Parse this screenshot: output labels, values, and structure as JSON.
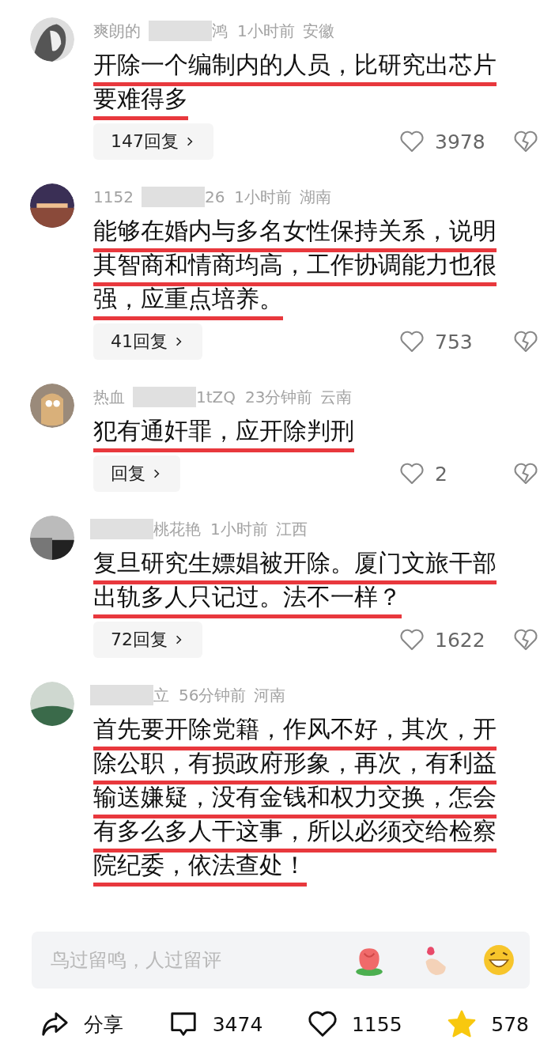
{
  "comments": [
    {
      "name_parts": [
        {
          "kind": "text",
          "text": "爽朗的"
        },
        {
          "kind": "blur"
        },
        {
          "kind": "text",
          "text": "鸿"
        }
      ],
      "time": "1小时前",
      "location": "安徽",
      "text": "开除一个编制内的人员，比研究出芯片要难得多",
      "marked": true,
      "reply": "147回复",
      "likes": "3978",
      "liked": false
    },
    {
      "name_parts": [
        {
          "kind": "text",
          "text": "1152"
        },
        {
          "kind": "blur"
        },
        {
          "kind": "text",
          "text": "26"
        }
      ],
      "time": "1小时前",
      "location": "湖南",
      "text": "能够在婚内与多名女性保持关系，说明其智商和情商均高，工作协调能力也很强，应重点培养。",
      "marked": true,
      "reply": "41回复",
      "likes": "753",
      "liked": false
    },
    {
      "name_parts": [
        {
          "kind": "text",
          "text": "热血"
        },
        {
          "kind": "blur"
        },
        {
          "kind": "text",
          "text": "1tZQ"
        }
      ],
      "time": "23分钟前",
      "location": "云南",
      "text": "犯有通奸罪，应开除判刑",
      "marked": true,
      "reply": "回复",
      "likes": "2",
      "liked": false
    },
    {
      "name_parts": [
        {
          "kind": "blur"
        },
        {
          "kind": "text",
          "text": "桃花艳"
        }
      ],
      "time": "1小时前",
      "location": "江西",
      "text": "复旦研究生嫖娼被开除。厦门文旅干部出轨多人只记过。法不一样？",
      "marked": true,
      "reply": "72回复",
      "likes": "1622",
      "liked": false
    },
    {
      "name_parts": [
        {
          "kind": "blur"
        },
        {
          "kind": "text",
          "text": "立"
        }
      ],
      "time": "56分钟前",
      "location": "河南",
      "text": "首先要开除党籍，作风不好，其次，开除公职，有损政府形象，再次，有利益输送嫌疑，没有金钱和权力交换，怎会有多么多人干这事，所以必须交给检察院纪委，依法查处！",
      "marked": true
    }
  ],
  "input": {
    "placeholder": "鸟过留鸣，人过留评"
  },
  "actions": [
    {
      "kind": "share",
      "label": "分享"
    },
    {
      "kind": "comment",
      "label": "3474"
    },
    {
      "kind": "like",
      "label": "1155",
      "selected": false
    },
    {
      "kind": "favorite",
      "label": "578",
      "selected": true
    }
  ]
}
